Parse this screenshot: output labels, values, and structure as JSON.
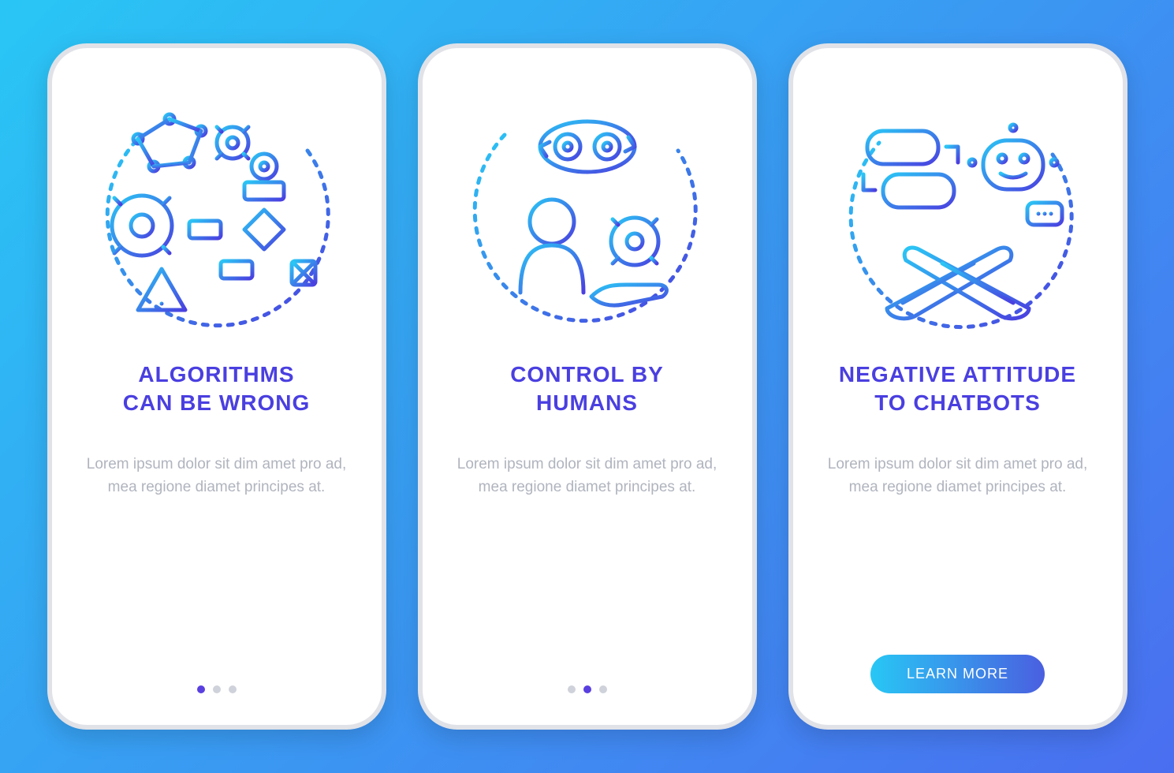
{
  "screens": [
    {
      "icon_name": "algorithms-wrong-icon",
      "title": "ALGORITHMS\nCAN BE WRONG",
      "body": "Lorem ipsum dolor sit dim amet pro ad, mea regione diamet principes at.",
      "active_dot_index": 0,
      "show_button": false
    },
    {
      "icon_name": "control-by-humans-icon",
      "title": "CONTROL BY\nHUMANS",
      "body": "Lorem ipsum dolor sit dim amet pro ad, mea regione diamet principes at.",
      "active_dot_index": 1,
      "show_button": false
    },
    {
      "icon_name": "negative-chatbots-icon",
      "title": "NEGATIVE ATTITUDE\nTO CHATBOTS",
      "body": "Lorem ipsum dolor sit dim amet pro ad, mea regione diamet principes at.",
      "active_dot_index": 2,
      "show_button": true
    }
  ],
  "button_label": "LEARN MORE",
  "colors": {
    "grad_start": "#2ac7f5",
    "grad_end": "#4a3fe0",
    "title": "#4a3fe0",
    "body": "#b0b4be",
    "dot_inactive": "#cfd2da"
  }
}
